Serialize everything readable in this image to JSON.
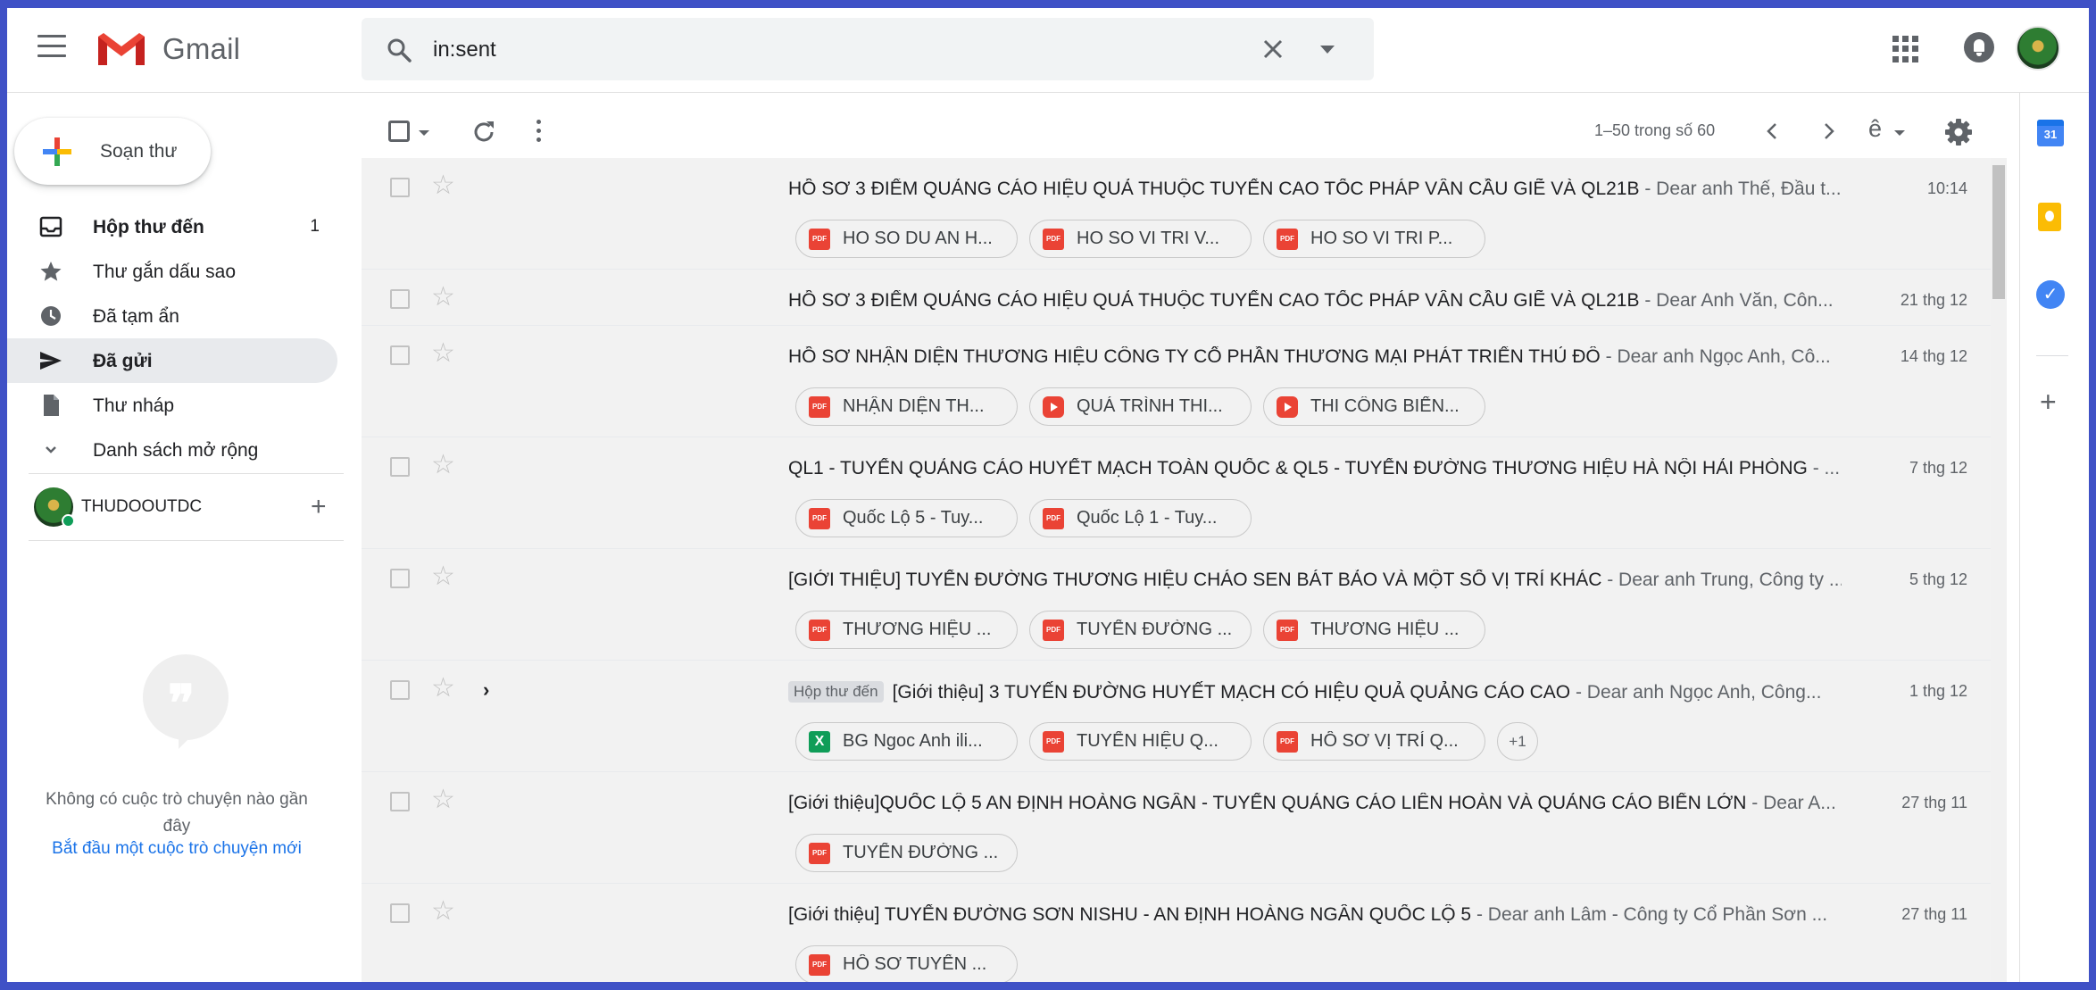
{
  "app": {
    "name": "Gmail"
  },
  "search": {
    "query": "in:sent"
  },
  "compose": {
    "label": "Soạn thư"
  },
  "sidebar": {
    "items": [
      {
        "label": "Hộp thư đến",
        "count": "1",
        "icon": "inbox-icon",
        "bold": true
      },
      {
        "label": "Thư gắn dấu sao",
        "count": "",
        "icon": "star-icon",
        "bold": false
      },
      {
        "label": "Đã tạm ẩn",
        "count": "",
        "icon": "clock-icon",
        "bold": false
      },
      {
        "label": "Đã gửi",
        "count": "",
        "icon": "send-icon",
        "bold": true,
        "active": true
      },
      {
        "label": "Thư nháp",
        "count": "",
        "icon": "draft-icon",
        "bold": false
      },
      {
        "label": "Danh sách mở rộng",
        "count": "",
        "icon": "chevron-down-icon",
        "bold": false
      }
    ]
  },
  "hangouts": {
    "user": "THUDOOUTDC",
    "empty_text": "Không có cuộc trò chuyện nào gần đây",
    "start_link": "Bắt đầu một cuộc trò chuyện mới"
  },
  "toolbar": {
    "pager": "1–50 trong số 60",
    "lang": "ê"
  },
  "emails": [
    {
      "subject": "HỒ SƠ 3 ĐIỂM QUẢNG CÁO HIỆU QUẢ THUỘC TUYẾN CAO TỐC PHÁP VÂN CẦU GIẼ VÀ QL21B",
      "snippet": " - Dear anh Thế, Đầu t...",
      "date": "10:14",
      "tag": "",
      "attachments": [
        {
          "name": "HO SO DU AN H...",
          "type": "pdf"
        },
        {
          "name": "HO SO VI TRI V...",
          "type": "pdf"
        },
        {
          "name": "HO SO VI TRI P...",
          "type": "pdf"
        }
      ],
      "more": ""
    },
    {
      "subject": "HỒ SƠ 3 ĐIỂM QUẢNG CÁO HIỆU QUẢ THUỘC TUYẾN CAO TỐC PHÁP VÂN CẦU GIẼ VÀ QL21B",
      "snippet": " - Dear Anh Văn, Côn...",
      "date": "21 thg 12",
      "tag": "",
      "attachments": [],
      "more": ""
    },
    {
      "subject": "HỒ SƠ NHẬN DIỆN THƯƠNG HIỆU CÔNG TY CỔ PHẦN THƯƠNG MẠI PHÁT TRIỂN THỦ ĐÔ",
      "snippet": " - Dear anh Ngọc Anh, Cô...",
      "date": "14 thg 12",
      "tag": "",
      "attachments": [
        {
          "name": "NHẬN DIỆN TH...",
          "type": "pdf"
        },
        {
          "name": "QUÁ TRÌNH THI...",
          "type": "yt"
        },
        {
          "name": "THI CÔNG BIỂN...",
          "type": "yt"
        }
      ],
      "more": ""
    },
    {
      "subject": "QL1 - TUYẾN QUẢNG CÁO HUYẾT MẠCH TOÀN QUỐC & QL5 - TUYẾN ĐƯỜNG THƯƠNG HIỆU HÀ NỘI HẢI PHÒNG",
      "snippet": " - ...",
      "date": "7 thg 12",
      "tag": "",
      "attachments": [
        {
          "name": "Quốc Lộ 5 - Tuy...",
          "type": "pdf"
        },
        {
          "name": "Quốc Lộ 1 - Tuy...",
          "type": "pdf"
        }
      ],
      "more": ""
    },
    {
      "subject": "[GIỚI THIỆU] TUYẾN ĐƯỜNG THƯƠNG HIỆU CHÁO SEN BÁT BẢO VÀ MỘT SỐ VỊ TRÍ KHÁC",
      "snippet": " - Dear anh Trung, Công ty ...",
      "date": "5 thg 12",
      "tag": "",
      "attachments": [
        {
          "name": "THƯƠNG HIỆU ...",
          "type": "pdf"
        },
        {
          "name": "TUYẾN ĐƯỜNG ...",
          "type": "pdf"
        },
        {
          "name": "THƯƠNG HIỆU ...",
          "type": "pdf"
        }
      ],
      "more": ""
    },
    {
      "subject": "[Giới thiệu] 3 TUYẾN ĐƯỜNG HUYẾT MẠCH CÓ HIỆU QUẢ QUẢNG CÁO CAO",
      "snippet": " - Dear anh Ngọc Anh, Công...",
      "date": "1 thg 12",
      "tag": "Hộp thư đến",
      "attachments": [
        {
          "name": "BG Ngoc Anh ili...",
          "type": "xls"
        },
        {
          "name": "TUYẾN HIỆU Q...",
          "type": "pdf"
        },
        {
          "name": "HỒ SƠ VỊ TRÍ Q...",
          "type": "pdf"
        }
      ],
      "more": "+1"
    },
    {
      "subject": "[Giới thiệu]QUỐC LỘ 5 AN ĐỊNH HOÀNG NGÂN - TUYẾN QUẢNG CÁO LIÊN HOÀN VÀ QUẢNG CÁO BIỂN LỚN",
      "snippet": " - Dear A...",
      "date": "27 thg 11",
      "tag": "",
      "attachments": [
        {
          "name": "TUYẾN ĐƯỜNG ...",
          "type": "pdf"
        }
      ],
      "more": ""
    },
    {
      "subject": "[Giới thiệu] TUYẾN ĐƯỜNG SƠN NISHU - AN ĐỊNH HOÀNG NGÂN QUỐC LỘ 5",
      "snippet": " - Dear anh Lâm - Công ty Cổ Phần Sơn ...",
      "date": "27 thg 11",
      "tag": "",
      "attachments": [
        {
          "name": "HỒ SƠ TUYẾN ...",
          "type": "pdf"
        }
      ],
      "more": ""
    }
  ],
  "side_panel": {
    "calendar_day": "31"
  },
  "colors": {
    "accent_blue": "#1a73e8",
    "frame_border": "#3f51c6",
    "pdf_red": "#ea4335",
    "sheet_green": "#0f9d58"
  }
}
